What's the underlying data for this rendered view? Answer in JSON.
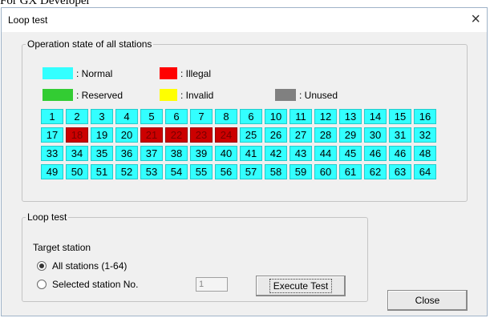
{
  "caption": "For GX Developer",
  "window": {
    "title": "Loop test",
    "close_glyph": "×"
  },
  "operation_state": {
    "legend": "Operation state of all stations",
    "legend_items": [
      {
        "label": ": Normal",
        "color": "#33ffff"
      },
      {
        "label": ": Illegal",
        "color": "#ff0000"
      },
      {
        "label": ": Reserved",
        "color": "#33cc33"
      },
      {
        "label": ": Invalid",
        "color": "#ffff00"
      },
      {
        "label": ": Unused",
        "color": "#808080"
      }
    ],
    "stations": [
      {
        "no": "1",
        "state": "normal"
      },
      {
        "no": "2",
        "state": "normal"
      },
      {
        "no": "3",
        "state": "normal"
      },
      {
        "no": "4",
        "state": "normal"
      },
      {
        "no": "5",
        "state": "normal"
      },
      {
        "no": "6",
        "state": "normal"
      },
      {
        "no": "7",
        "state": "normal"
      },
      {
        "no": "8",
        "state": "normal"
      },
      {
        "no": "6",
        "state": "normal"
      },
      {
        "no": "10",
        "state": "normal"
      },
      {
        "no": "11",
        "state": "normal"
      },
      {
        "no": "12",
        "state": "normal"
      },
      {
        "no": "13",
        "state": "normal"
      },
      {
        "no": "14",
        "state": "normal"
      },
      {
        "no": "15",
        "state": "normal"
      },
      {
        "no": "16",
        "state": "normal"
      },
      {
        "no": "17",
        "state": "normal"
      },
      {
        "no": "18",
        "state": "illegal"
      },
      {
        "no": "19",
        "state": "normal"
      },
      {
        "no": "20",
        "state": "normal"
      },
      {
        "no": "21",
        "state": "illegal"
      },
      {
        "no": "22",
        "state": "illegal"
      },
      {
        "no": "23",
        "state": "illegal"
      },
      {
        "no": "24",
        "state": "illegal"
      },
      {
        "no": "25",
        "state": "normal"
      },
      {
        "no": "26",
        "state": "normal"
      },
      {
        "no": "27",
        "state": "normal"
      },
      {
        "no": "28",
        "state": "normal"
      },
      {
        "no": "29",
        "state": "normal"
      },
      {
        "no": "30",
        "state": "normal"
      },
      {
        "no": "31",
        "state": "normal"
      },
      {
        "no": "32",
        "state": "normal"
      },
      {
        "no": "33",
        "state": "normal"
      },
      {
        "no": "34",
        "state": "normal"
      },
      {
        "no": "35",
        "state": "normal"
      },
      {
        "no": "36",
        "state": "normal"
      },
      {
        "no": "37",
        "state": "normal"
      },
      {
        "no": "38",
        "state": "normal"
      },
      {
        "no": "39",
        "state": "normal"
      },
      {
        "no": "40",
        "state": "normal"
      },
      {
        "no": "41",
        "state": "normal"
      },
      {
        "no": "42",
        "state": "normal"
      },
      {
        "no": "43",
        "state": "normal"
      },
      {
        "no": "44",
        "state": "normal"
      },
      {
        "no": "45",
        "state": "normal"
      },
      {
        "no": "46",
        "state": "normal"
      },
      {
        "no": "46",
        "state": "normal"
      },
      {
        "no": "48",
        "state": "normal"
      },
      {
        "no": "49",
        "state": "normal"
      },
      {
        "no": "50",
        "state": "normal"
      },
      {
        "no": "51",
        "state": "normal"
      },
      {
        "no": "52",
        "state": "normal"
      },
      {
        "no": "53",
        "state": "normal"
      },
      {
        "no": "54",
        "state": "normal"
      },
      {
        "no": "55",
        "state": "normal"
      },
      {
        "no": "56",
        "state": "normal"
      },
      {
        "no": "57",
        "state": "normal"
      },
      {
        "no": "58",
        "state": "normal"
      },
      {
        "no": "59",
        "state": "normal"
      },
      {
        "no": "60",
        "state": "normal"
      },
      {
        "no": "61",
        "state": "normal"
      },
      {
        "no": "62",
        "state": "normal"
      },
      {
        "no": "63",
        "state": "normal"
      },
      {
        "no": "64",
        "state": "normal"
      }
    ]
  },
  "loop_test": {
    "legend": "Loop test",
    "target_label": "Target station",
    "options": [
      {
        "label": "All stations (1-64)",
        "selected": true
      },
      {
        "label": "Selected station No.",
        "selected": false
      }
    ],
    "station_no_value": "1",
    "execute_label": "Execute Test"
  },
  "close_label": "Close"
}
